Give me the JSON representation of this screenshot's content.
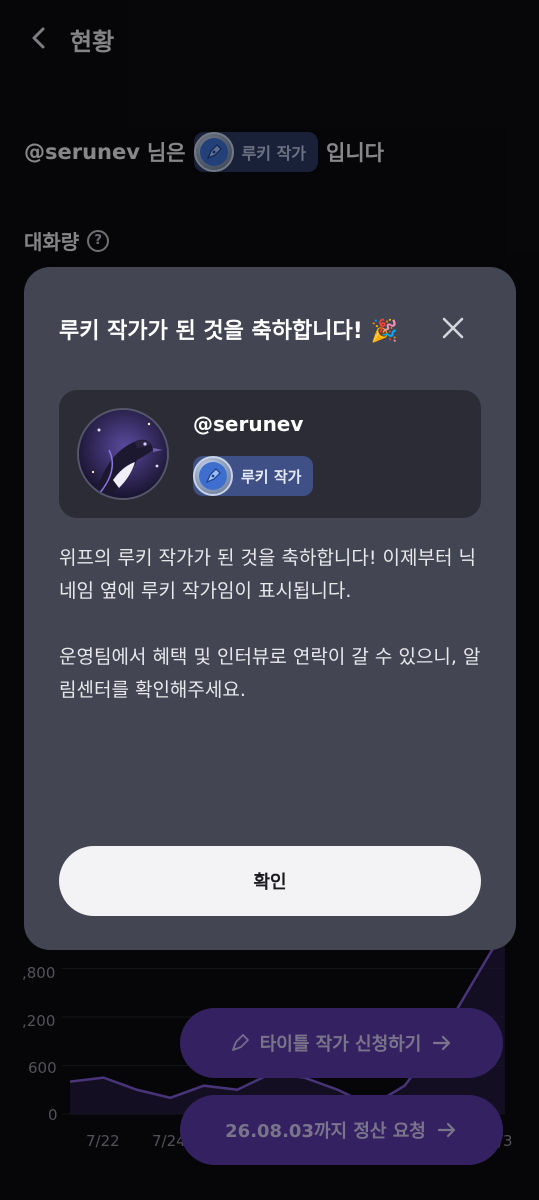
{
  "header": {
    "title": "현황"
  },
  "status": {
    "username": "@serunev",
    "suffix_before": "님은",
    "badge_label": "루키 작가",
    "suffix_after": "입니다"
  },
  "section": {
    "label": "대화량"
  },
  "chart_data": {
    "type": "area",
    "title": "",
    "xlabel": "",
    "ylabel": "",
    "y_ticks_visible": [
      ",800",
      ",200",
      "600",
      "0"
    ],
    "x_ticks_visible": [
      "7/22",
      "7/24",
      "/3"
    ],
    "ylim": [
      0,
      2400
    ],
    "series": [
      {
        "values": [
          400,
          450,
          300,
          200,
          350,
          300,
          500,
          450,
          300,
          100,
          350,
          900,
          1600,
          2300
        ]
      }
    ]
  },
  "buttons": {
    "title_apply": "타이틀 작가 신청하기",
    "settle_request": "26.08.03까지 정산 요청"
  },
  "modal": {
    "title": "루키 작가가 된 것을 축하합니다!",
    "title_emoji": "🎉",
    "username": "@serunev",
    "badge_label": "루키 작가",
    "paragraph1": "위프의 루키 작가가 된 것을 축하합니다! 이제부터 닉네임 옆에 루키 작가임이 표시됩니다.",
    "paragraph2": "운영팀에서 혜택 및 인터뷰로 연락이 갈 수 있으니, 알림센터를 확인해주세요.",
    "confirm_label": "확인"
  },
  "colors": {
    "modal_bg": "#434552",
    "accent_purple": "#5b3aa8",
    "badge_blue": "#3e6fcf"
  }
}
